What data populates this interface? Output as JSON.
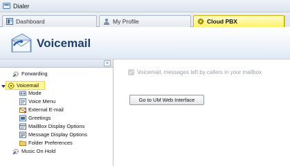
{
  "window": {
    "title": "Dialer"
  },
  "tabs": [
    {
      "label": "Dashboard",
      "icon": "dashboard-icon"
    },
    {
      "label": "My Profile",
      "icon": "user-icon"
    },
    {
      "label": "Cloud PBX",
      "icon": "gear-icon",
      "active": true
    }
  ],
  "header": {
    "title": "Voicemail",
    "icon": "voicemail-envelope-icon"
  },
  "sidebar": {
    "collapse_label": "«",
    "items": [
      {
        "label": "Forwarding",
        "icon": "forwarding-icon"
      },
      {
        "label": "Voicemail",
        "icon": "voicemail-icon",
        "selected": true,
        "expanded": true
      },
      {
        "label": "Mode",
        "icon": "mode-icon"
      },
      {
        "label": "Voice Menu",
        "icon": "voice-menu-icon"
      },
      {
        "label": "External E-mail",
        "icon": "external-email-icon"
      },
      {
        "label": "Greetings",
        "icon": "greetings-icon"
      },
      {
        "label": "MailBox Display Options",
        "icon": "mailbox-icon"
      },
      {
        "label": "Message Display Options",
        "icon": "message-icon"
      },
      {
        "label": "Folder Preferences",
        "icon": "folder-icon"
      },
      {
        "label": "Music On Hold",
        "icon": "music-icon"
      }
    ]
  },
  "content": {
    "voicemail_checkbox_label": "Voicemail, messages left by callers in your mailbox",
    "voicemail_checked": true,
    "um_button_label": "Go to UM Web Interface"
  },
  "colors": {
    "active_tab": "#fff36a",
    "selected_node": "#fff59a",
    "title": "#1e3f73"
  }
}
